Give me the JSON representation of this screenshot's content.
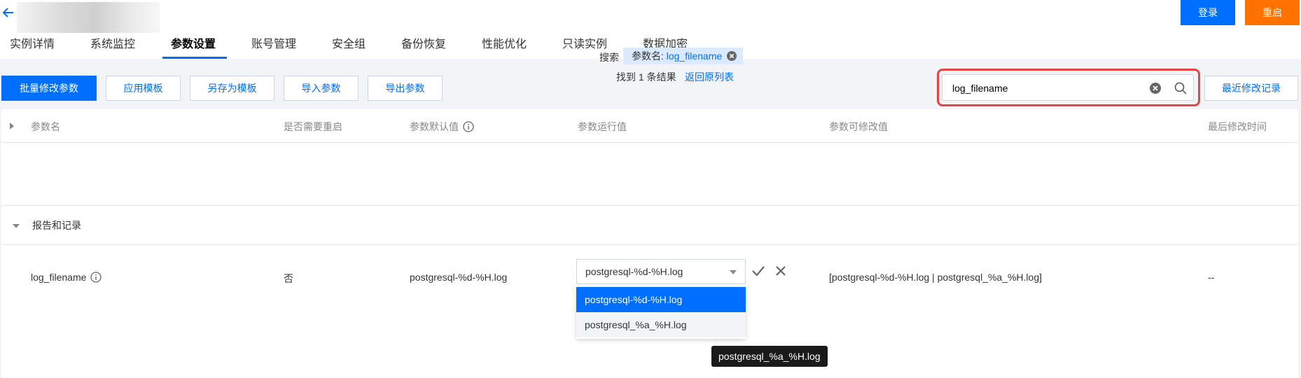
{
  "header": {
    "back_icon": "arrow-left-icon",
    "login_label": "登录",
    "restart_label": "重启",
    "login_color": "#006eff",
    "restart_color": "#ff7200"
  },
  "tabs": [
    {
      "label": "实例详情"
    },
    {
      "label": "系统监控"
    },
    {
      "label": "参数设置",
      "active": true
    },
    {
      "label": "账号管理"
    },
    {
      "label": "安全组"
    },
    {
      "label": "备份恢复"
    },
    {
      "label": "性能优化"
    },
    {
      "label": "只读实例"
    },
    {
      "label": "数据加密"
    }
  ],
  "toolbar": {
    "batch_edit": "批量修改参数",
    "apply_template": "应用模板",
    "save_as_template": "另存为模板",
    "import_params": "导入参数",
    "export_params": "导出参数",
    "recent_changes": "最近修改记录"
  },
  "search": {
    "value": "log_filename",
    "highlight_color": "#e54545"
  },
  "table": {
    "columns": {
      "name": "参数名",
      "restart": "是否需要重启",
      "default": "参数默认值",
      "running": "参数运行值",
      "allowed": "参数可修改值",
      "modified": "最后修改时间"
    },
    "search_summary": {
      "label": "搜索",
      "tag_key": "参数名:",
      "tag_value": "log_filename",
      "result": "找到 1 条结果",
      "back_link": "返回原列表"
    },
    "group": "报告和记录",
    "row": {
      "name": "log_filename",
      "restart": "否",
      "default": "postgresql-%d-%H.log",
      "running_value": "postgresql-%d-%H.log",
      "allowed": "[postgresql-%d-%H.log | postgresql_%a_%H.log]",
      "modified": "--"
    },
    "dropdown_options": [
      "postgresql-%d-%H.log",
      "postgresql_%a_%H.log"
    ],
    "tooltip": "postgresql_%a_%H.log"
  }
}
